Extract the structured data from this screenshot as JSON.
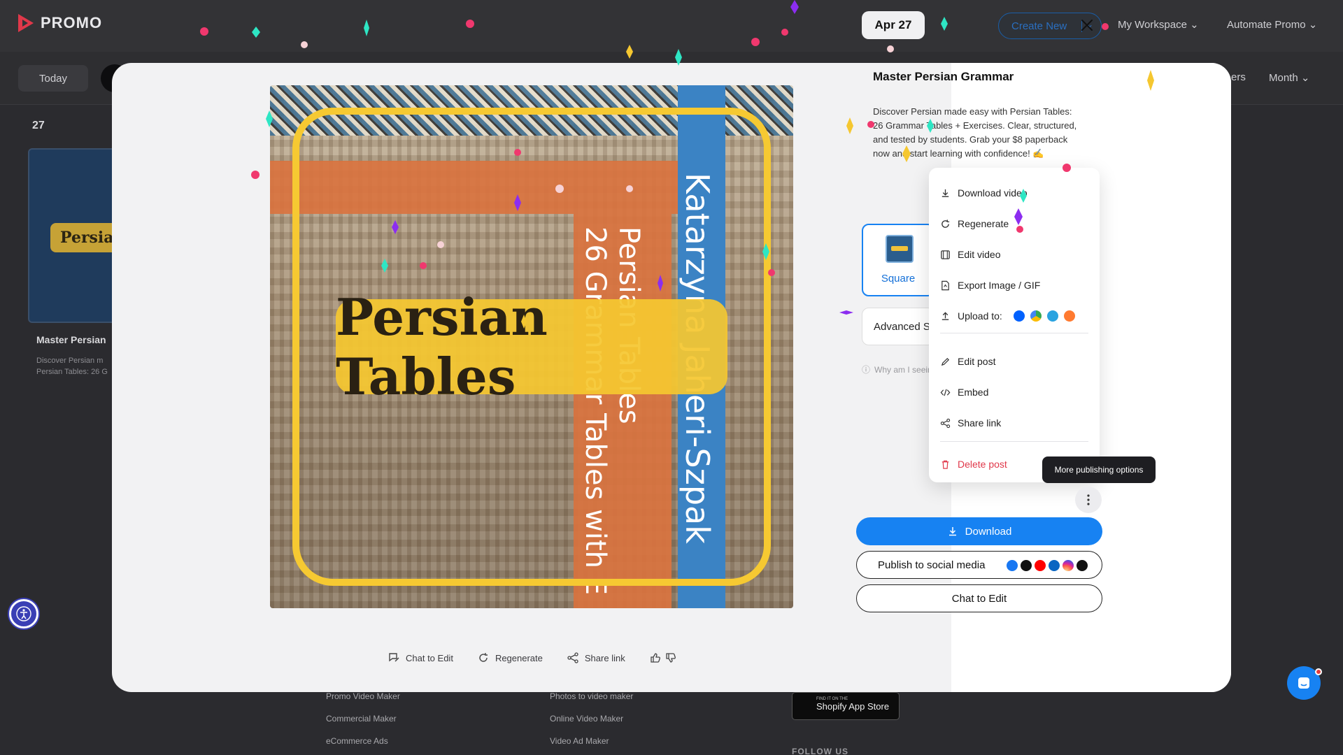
{
  "app": {
    "logo_text": "PROMO",
    "create_new": "Create New",
    "workspace": "My Workspace",
    "automate": "Automate Promo",
    "filters": "ers",
    "month": "Month",
    "today": "Today"
  },
  "calendar": {
    "day": "27",
    "card_title": "Persian",
    "card_label": "Master Persian",
    "card_sub": "Discover Persian m Persian Tables: 26 G"
  },
  "footer": {
    "col1": [
      "Promo Video Maker",
      "Commercial Maker",
      "eCommerce Ads"
    ],
    "col2": [
      "Photos to video maker",
      "Online Video Maker",
      "Video Ad Maker"
    ],
    "store_small": "FIND IT ON THE",
    "store_name": "Shopify App Store",
    "follow": "FOLLOW US"
  },
  "preview": {
    "title": "Persian Tables",
    "author": "Katarzyna Jaheri-Szpak",
    "line1": "Persian Tables",
    "line2": "26 Grammar Tables with E"
  },
  "actions": {
    "chat": "Chat to Edit",
    "regenerate": "Regenerate",
    "share": "Share link"
  },
  "panel": {
    "date": "Apr 27",
    "title": "Master Persian Grammar",
    "description": "Discover Persian made easy with Persian Tables: 26 Grammar Tables + Exercises. Clear, structured, and tested by students. Grab your $8 paperback now and start learning with confidence! ✍️",
    "format": "Square",
    "advanced": "Advanced Settings",
    "why": "Why am I seeing this?"
  },
  "menu": {
    "download_video": "Download video",
    "regenerate": "Regenerate",
    "edit_video": "Edit video",
    "export": "Export Image / GIF",
    "upload_to": "Upload to:",
    "edit_post": "Edit post",
    "embed": "Embed",
    "share_link": "Share link",
    "delete_post": "Delete post"
  },
  "tooltip": "More publishing options",
  "buttons": {
    "download": "Download",
    "publish": "Publish to social media",
    "chat": "Chat to Edit"
  },
  "colors": {
    "primary": "#1782f2",
    "danger": "#e0384a",
    "accent_yellow": "#f6c932"
  },
  "upload_icons": [
    "dropbox-icon",
    "google-drive-icon",
    "telegram-icon",
    "hubspot-icon"
  ],
  "social_icons": [
    "facebook-icon",
    "x-icon",
    "youtube-icon",
    "linkedin-icon",
    "instagram-icon",
    "tiktok-icon"
  ]
}
